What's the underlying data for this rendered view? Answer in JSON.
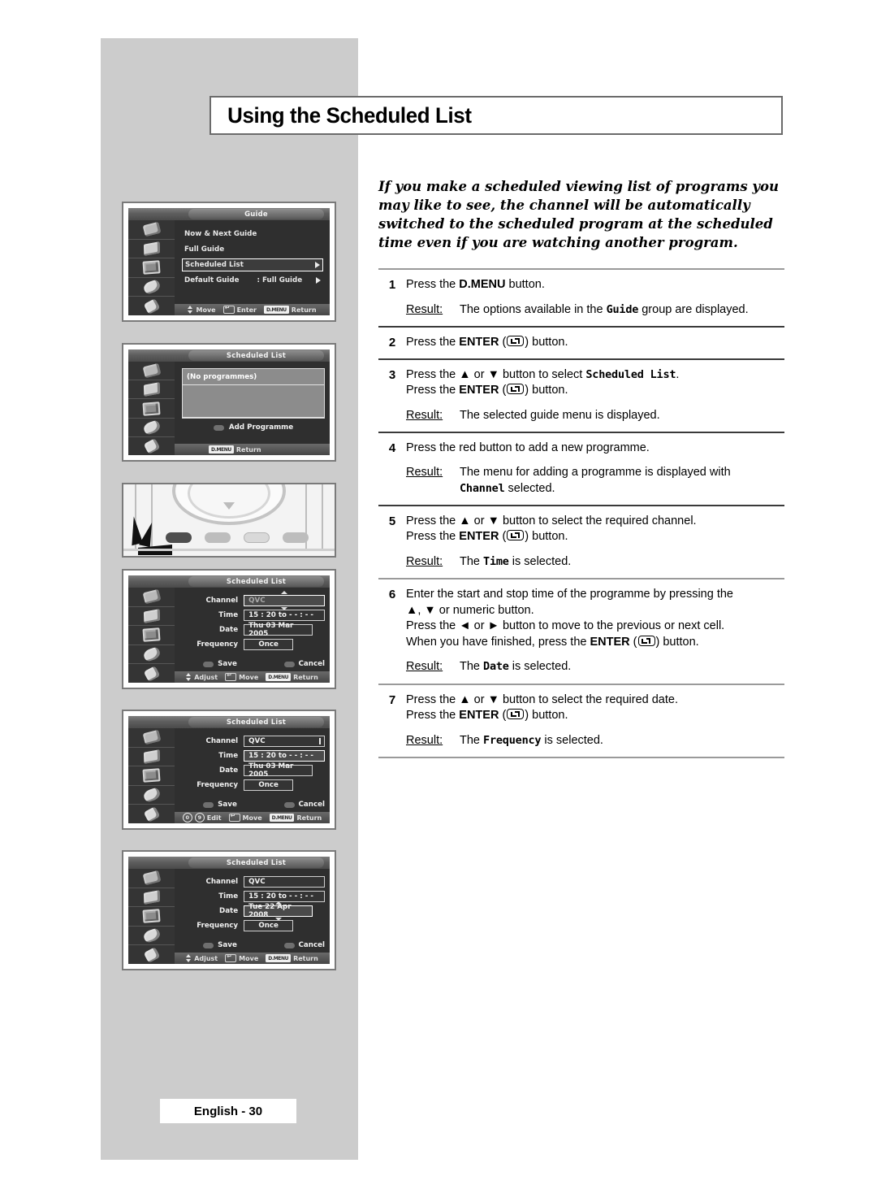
{
  "page": {
    "title": "Using the Scheduled List",
    "footer_label": "English - 30",
    "intro": "If you make a scheduled viewing list of programs you may like to see, the channel will be automatically switched to the scheduled program at the scheduled time even if you are watching another program."
  },
  "steps": [
    {
      "num": "1",
      "lines": [
        "Press the D.MENU button."
      ],
      "result_label": "Result:",
      "result_text": "The options available in the Guide group are displayed."
    },
    {
      "num": "2",
      "lines": [
        "Press the ENTER ( ) button."
      ],
      "result_label": "",
      "result_text": ""
    },
    {
      "num": "3",
      "lines": [
        "Press the ▲ or ▼ button to select Scheduled List.",
        "Press the ENTER ( ) button."
      ],
      "result_label": "Result:",
      "result_text": "The selected guide menu is displayed."
    },
    {
      "num": "4",
      "lines": [
        "Press the red button to add a new programme."
      ],
      "result_label": "Result:",
      "result_text": "The menu for adding a programme is displayed with Channel selected."
    },
    {
      "num": "5",
      "lines": [
        "Press the ▲ or ▼ button to select the required channel.",
        "Press the ENTER ( ) button."
      ],
      "result_label": "Result:",
      "result_text": "The Time is selected."
    },
    {
      "num": "6",
      "lines": [
        "Enter the start and stop time of the programme by pressing the ▲, ▼ or numeric button.",
        "Press the ◄ or ► button to move to the previous or next cell.",
        "When you have finished, press the ENTER ( ) button."
      ],
      "result_label": "Result:",
      "result_text": "The Date is selected."
    },
    {
      "num": "7",
      "lines": [
        "Press the ▲ or ▼ button to select the required date.",
        "Press the ENTER ( ) button."
      ],
      "result_label": "Result:",
      "result_text": "The Frequency is selected."
    }
  ],
  "step_text": {
    "s1_a": "Press the ",
    "s1_b": "D.MENU",
    "s1_c": " button.",
    "r1_a": "The options available in the ",
    "r1_mono": "Guide",
    "r1_b": " group are displayed.",
    "s2_a": "Press the ",
    "s2_b": "ENTER",
    "s2_c": " (",
    "s2_d": ") button.",
    "s3_a": "Press the ▲ or ▼ button to select ",
    "s3_mono": "Scheduled List",
    "s3_b": ".",
    "r3": "The selected guide menu is displayed.",
    "s4": "Press the red button to add a new programme.",
    "r4_a": "The menu for adding a programme is displayed with",
    "r4_mono": "Channel",
    "r4_b": " selected.",
    "s5": "Press the ▲ or ▼ button to select the required channel.",
    "r5_a": "The ",
    "r5_mono": "Time",
    "r5_b": " is selected.",
    "s6_a": "Enter the start and stop time of the programme by pressing the",
    "s6_b": "▲, ▼ or numeric button.",
    "s6_c": "Press the ◄ or ► button to move to the previous or next cell.",
    "s6_d1": "When you have finished, press the ",
    "s6_d2": "ENTER",
    "s6_d3": " (",
    "s6_d4": ") button.",
    "r6_a": "The ",
    "r6_mono": "Date",
    "r6_b": " is selected.",
    "s7": "Press the ▲ or ▼ button to select the required date.",
    "r7_a": "The ",
    "r7_mono": "Frequency",
    "r7_b": " is selected.",
    "result_label": "Result:",
    "press_enter": "Press the ",
    "enter_word": "ENTER",
    "paren_open": " (",
    "paren_close": ") button."
  },
  "screens": {
    "guide": {
      "title": "Guide",
      "items": [
        {
          "label": "Now & Next Guide",
          "value": "",
          "selected": false,
          "arrow": false
        },
        {
          "label": "Full Guide",
          "value": "",
          "selected": false,
          "arrow": false
        },
        {
          "label": "Scheduled List",
          "value": "",
          "selected": true,
          "arrow": true
        },
        {
          "label": "Default Guide",
          "value": ": Full Guide",
          "selected": false,
          "arrow": true
        }
      ],
      "hints": [
        {
          "icon": "updown-icon",
          "label": "Move"
        },
        {
          "icon": "enter-icon",
          "label": "Enter"
        },
        {
          "icon": "dmenu-icon",
          "label": "D.MENU",
          "label2": "Return"
        }
      ],
      "dmenu_text": "D.MENU",
      "return_text": "Return"
    },
    "scheduled_empty": {
      "title": "Scheduled List",
      "rows": [
        "(No programmes)",
        "",
        ""
      ],
      "add_label": "Add Programme",
      "dmenu_text": "D.MENU",
      "return_text": "Return"
    },
    "form_channel": {
      "title": "Scheduled List",
      "fields": [
        {
          "label": "Channel",
          "value": "QVC",
          "active": true,
          "carets": true
        },
        {
          "label": "Time",
          "value": "15 : 20 to - - : - -",
          "active": false,
          "carets": false
        },
        {
          "label": "Date",
          "value": "Thu 03 Mar 2005",
          "active": false,
          "carets": false
        },
        {
          "label": "Frequency",
          "value": "Once",
          "active": false,
          "carets": false
        }
      ],
      "save_label": "Save",
      "cancel_label": "Cancel",
      "hints": [
        "Adjust",
        "Move"
      ],
      "dmenu_text": "D.MENU",
      "return_text": "Return"
    },
    "form_time": {
      "title": "Scheduled List",
      "fields": [
        {
          "label": "Channel",
          "value": "QVC",
          "active": false,
          "carets": false
        },
        {
          "label": "Time",
          "value": "15 : 20 to - - : - -",
          "active": true,
          "carets": false
        },
        {
          "label": "Date",
          "value": "Thu 03 Mar 2005",
          "active": false,
          "carets": false
        },
        {
          "label": "Frequency",
          "value": "Once",
          "active": false,
          "carets": false
        }
      ],
      "save_label": "Save",
      "cancel_label": "Cancel",
      "edit_label": "Edit",
      "num_low": "0",
      "num_high": "9",
      "move_label": "Move",
      "dmenu_text": "D.MENU",
      "return_text": "Return"
    },
    "form_date": {
      "title": "Scheduled List",
      "fields": [
        {
          "label": "Channel",
          "value": "QVC",
          "active": false,
          "carets": false
        },
        {
          "label": "Time",
          "value": "15 : 20 to - - : - -",
          "active": false,
          "carets": false
        },
        {
          "label": "Date",
          "value": "Tue 22 Apr 2008",
          "active": true,
          "carets": true
        },
        {
          "label": "Frequency",
          "value": "Once",
          "active": false,
          "carets": false
        }
      ],
      "save_label": "Save",
      "cancel_label": "Cancel",
      "hints": [
        "Adjust",
        "Move"
      ],
      "dmenu_text": "D.MENU",
      "return_text": "Return"
    }
  },
  "colors": {
    "band_gray": "#cccccc",
    "frame_gray": "#7a7a7a",
    "osd_dark": "#2f2f2f",
    "rule_gray": "#9a9a9a"
  }
}
